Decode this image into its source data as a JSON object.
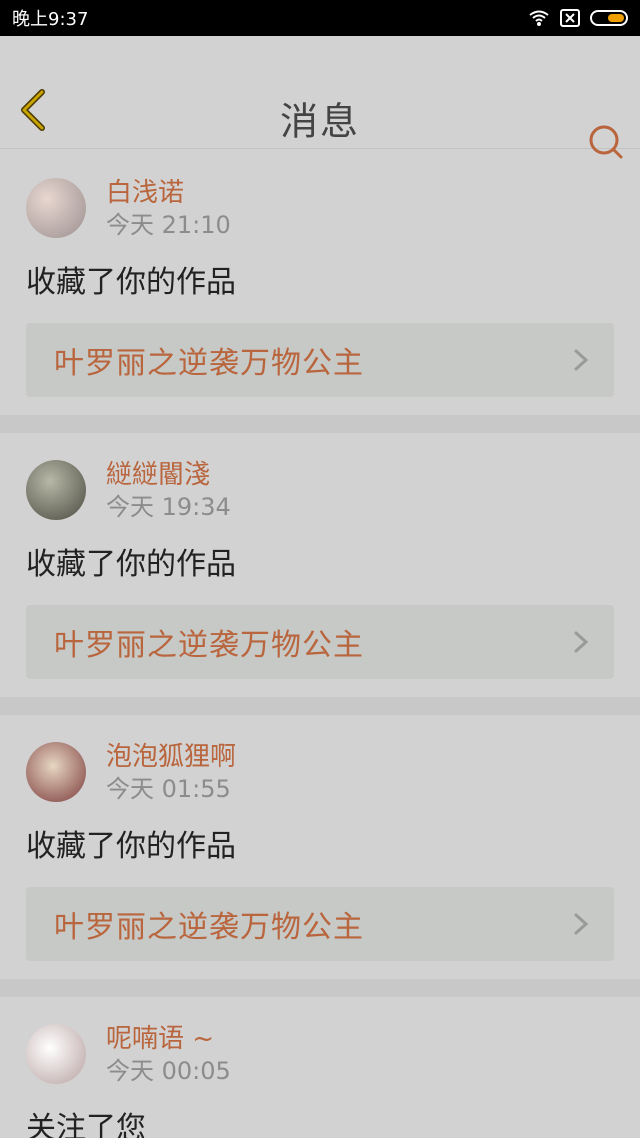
{
  "status_bar": {
    "time": "晚上9:37"
  },
  "header": {
    "title": "消息"
  },
  "notifications": [
    {
      "username": "白浅诺",
      "time": "今天 21:10",
      "action": "收藏了你的作品",
      "work_title": "叶罗丽之逆袭万物公主"
    },
    {
      "username": "縌縌閽淺",
      "time": "今天 19:34",
      "action": "收藏了你的作品",
      "work_title": "叶罗丽之逆袭万物公主"
    },
    {
      "username": "泡泡狐狸啊",
      "time": "今天 01:55",
      "action": "收藏了你的作品",
      "work_title": "叶罗丽之逆袭万物公主"
    },
    {
      "username": "呢喃语 ~",
      "time": "今天 00:05",
      "action": "关注了您"
    }
  ],
  "colors": {
    "accent": "#b9653d",
    "status_bar_bg": "#000000",
    "battery_fill": "#f0a000"
  },
  "icons": {
    "back": "back-arrow-icon",
    "search": "search-icon",
    "chevron": "chevron-right-icon",
    "wifi": "wifi-icon",
    "sim": "sim-x-icon",
    "battery": "battery-icon"
  }
}
